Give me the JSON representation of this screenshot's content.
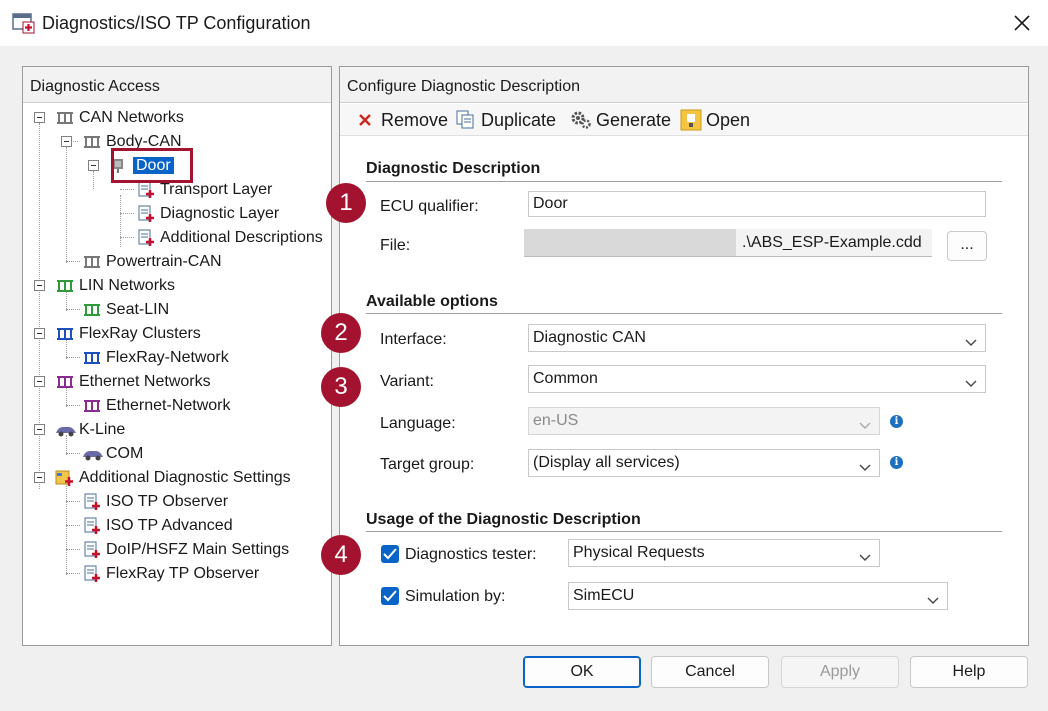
{
  "window": {
    "title": "Diagnostics/ISO TP Configuration"
  },
  "left_panel": {
    "header": "Diagnostic Access",
    "tree": {
      "can_networks": "CAN Networks",
      "body_can": "Body-CAN",
      "door": "Door",
      "transport_layer": "Transport Layer",
      "diagnostic_layer": "Diagnostic Layer",
      "additional_descriptions": "Additional Descriptions",
      "powertrain_can": "Powertrain-CAN",
      "lin_networks": "LIN Networks",
      "seat_lin": "Seat-LIN",
      "flexray_clusters": "FlexRay Clusters",
      "flexray_network": "FlexRay-Network",
      "ethernet_networks": "Ethernet Networks",
      "ethernet_network": "Ethernet-Network",
      "k_line": "K-Line",
      "com": "COM",
      "additional_diag_settings": "Additional Diagnostic Settings",
      "iso_tp_observer": "ISO TP Observer",
      "iso_tp_advanced": "ISO TP Advanced",
      "doip_settings": "DoIP/HSFZ Main Settings",
      "flexray_tp_observer": "FlexRay TP Observer"
    }
  },
  "right_panel": {
    "header": "Configure Diagnostic Description",
    "toolbar": {
      "remove": "Remove",
      "duplicate": "Duplicate",
      "generate": "Generate",
      "open": "Open"
    },
    "diag_description": {
      "title": "Diagnostic Description",
      "ecu_qualifier_label": "ECU qualifier:",
      "ecu_qualifier_value": "Door",
      "file_label": "File:",
      "file_value": ".\\ABS_ESP-Example.cdd",
      "browse_label": "..."
    },
    "available_options": {
      "title": "Available options",
      "interface_label": "Interface:",
      "interface_value": "Diagnostic CAN",
      "variant_label": "Variant:",
      "variant_value": "Common",
      "language_label": "Language:",
      "language_value": "en-US",
      "target_group_label": "Target group:",
      "target_group_value": "(Display all services)",
      "info_glyph": "i"
    },
    "usage": {
      "title": "Usage of the Diagnostic Description",
      "diag_tester_label": "Diagnostics tester:",
      "diag_tester_value": "Physical Requests",
      "diag_tester_checked": true,
      "simulation_label": "Simulation by:",
      "simulation_value": "SimECU",
      "simulation_checked": true
    },
    "badges": [
      "1",
      "2",
      "3",
      "4"
    ]
  },
  "buttons": {
    "ok": "OK",
    "cancel": "Cancel",
    "apply": "Apply",
    "help": "Help"
  },
  "colors": {
    "accent": "#0a64c8",
    "badge": "#a3122f",
    "highlight": "#a3122f"
  }
}
